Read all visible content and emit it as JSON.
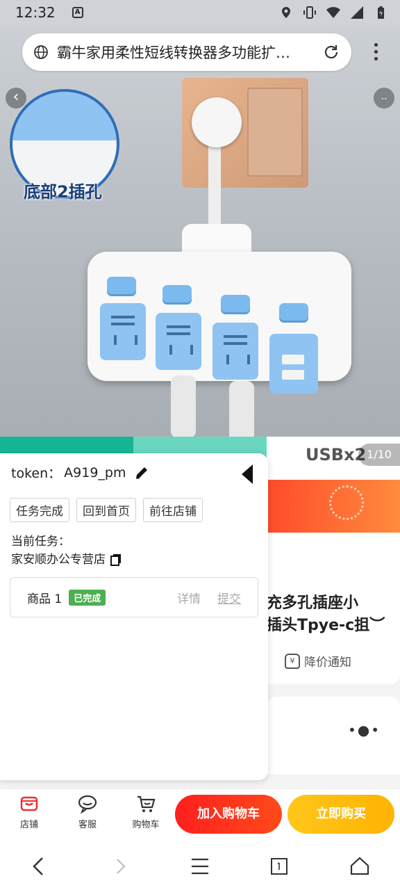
{
  "status_bar": {
    "time": "12:32",
    "notification_letter": "A",
    "icons": [
      "location-icon",
      "vibrate-icon",
      "wifi-icon",
      "signal-icon",
      "battery-icon"
    ]
  },
  "browser": {
    "page_title": "霸牛家用柔性短线转换器多功能扩…"
  },
  "hero": {
    "inset_label": "底部2插孔",
    "back_glyph": "‹",
    "dots_glyph": "‥"
  },
  "product_page": {
    "usb_label": "USBx2",
    "page_counter": "1/10",
    "title_partial": "充多孔插座小\n插头Tpye-c抯︶",
    "price_notify": "降价通知",
    "price_notify_glyph": "¥",
    "pager_dots": "•●•"
  },
  "task_panel": {
    "token_label": "token：",
    "token_value": "A919_pm",
    "buttons": [
      "任务完成",
      "回到首页",
      "前往店铺"
    ],
    "current_task_label": "当前任务：",
    "current_shop": "家安顺办公专营店",
    "item": {
      "name": "商品 1",
      "status": "已完成",
      "detail": "详情",
      "submit": "提交"
    }
  },
  "action_bar": {
    "shop": "店铺",
    "service": "客服",
    "cart": "购物车",
    "add_to_cart": "加入购物车",
    "buy_now": "立即购买"
  },
  "colors": {
    "cart_red": "#ff1f1f",
    "buy_yellow": "#ffc61a",
    "done_green": "#4caf50",
    "shop_icon_red": "#ee2f2f"
  }
}
